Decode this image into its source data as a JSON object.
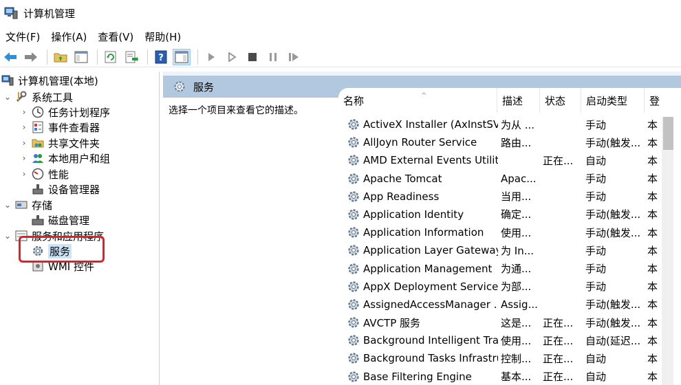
{
  "window": {
    "title": "计算机管理"
  },
  "menu": [
    "文件(F)",
    "操作(A)",
    "查看(V)",
    "帮助(H)"
  ],
  "toolbar": {
    "buttons": [
      "back-arrow-icon",
      "forward-arrow-icon",
      "folder-up-icon",
      "console-tree-icon",
      "refresh-icon",
      "export-list-icon",
      "help-icon",
      "show-action-pane-icon",
      "start-service-icon",
      "start-paused-icon",
      "stop-service-icon",
      "pause-service-icon",
      "restart-service-icon"
    ]
  },
  "tree": {
    "root": "计算机管理(本地)",
    "system_tools": "系统工具",
    "task_scheduler": "任务计划程序",
    "event_viewer": "事件查看器",
    "shared_folders": "共享文件夹",
    "local_users": "本地用户和组",
    "performance": "性能",
    "device_manager": "设备管理器",
    "storage": "存储",
    "disk_management": "磁盘管理",
    "services_apps": "服务和应用程序",
    "services": "服务",
    "wmi": "WMI 控件"
  },
  "panel": {
    "title": "服务",
    "description_hint": "选择一个项目来查看它的描述。"
  },
  "columns": {
    "name": "名称",
    "desc": "描述",
    "status": "状态",
    "startup": "启动类型",
    "logon": "登"
  },
  "services": [
    {
      "name": "ActiveX Installer (AxInstSV)",
      "desc": "为从 ...",
      "status": "",
      "startup": "手动",
      "logon": "本"
    },
    {
      "name": "AllJoyn Router Service",
      "desc": "路由...",
      "status": "",
      "startup": "手动(触发...",
      "logon": "本"
    },
    {
      "name": "AMD External Events Utility",
      "desc": "",
      "status": "正在...",
      "startup": "自动",
      "logon": "本"
    },
    {
      "name": "Apache Tomcat",
      "desc": "Apac...",
      "status": "",
      "startup": "手动",
      "logon": "本"
    },
    {
      "name": "App Readiness",
      "desc": "当用...",
      "status": "",
      "startup": "手动",
      "logon": "本"
    },
    {
      "name": "Application Identity",
      "desc": "确定...",
      "status": "",
      "startup": "手动(触发...",
      "logon": "本"
    },
    {
      "name": "Application Information",
      "desc": "使用...",
      "status": "",
      "startup": "手动(触发...",
      "logon": "本"
    },
    {
      "name": "Application Layer Gateway ...",
      "desc": "为 In...",
      "status": "",
      "startup": "手动",
      "logon": "本"
    },
    {
      "name": "Application Management",
      "desc": "为通...",
      "status": "",
      "startup": "手动",
      "logon": "本"
    },
    {
      "name": "AppX Deployment Service ...",
      "desc": "为部...",
      "status": "",
      "startup": "手动",
      "logon": "本"
    },
    {
      "name": "AssignedAccessManager ...",
      "desc": "Assig...",
      "status": "",
      "startup": "手动(触发...",
      "logon": "本"
    },
    {
      "name": "AVCTP 服务",
      "desc": "这是...",
      "status": "正在...",
      "startup": "手动(触发...",
      "logon": "本"
    },
    {
      "name": "Background Intelligent Tra...",
      "desc": "使用...",
      "status": "正在...",
      "startup": "自动(延迟...",
      "logon": "本"
    },
    {
      "name": "Background Tasks Infrastru...",
      "desc": "控制...",
      "status": "正在...",
      "startup": "自动",
      "logon": "本"
    },
    {
      "name": "Base Filtering Engine",
      "desc": "基本...",
      "status": "正在...",
      "startup": "自动",
      "logon": "本"
    }
  ],
  "colors": {
    "header_bg": "#b1c8de",
    "selection": "#cce4f7",
    "highlight_border": "#e21f26"
  }
}
